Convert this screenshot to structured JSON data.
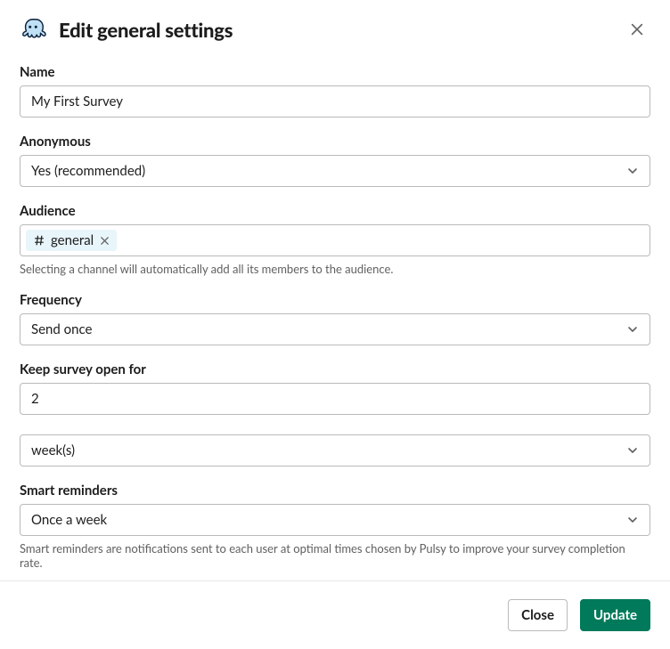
{
  "modal": {
    "title": "Edit general settings"
  },
  "fields": {
    "name": {
      "label": "Name",
      "value": "My First Survey"
    },
    "anonymous": {
      "label": "Anonymous",
      "value": "Yes (recommended)"
    },
    "audience": {
      "label": "Audience",
      "chip_text": "general",
      "helper": "Selecting a channel will automatically add all its members to the audience."
    },
    "frequency": {
      "label": "Frequency",
      "value": "Send once"
    },
    "keep_open": {
      "label": "Keep survey open for",
      "value": "2"
    },
    "keep_open_unit": {
      "value": "week(s)"
    },
    "smart_reminders": {
      "label": "Smart reminders",
      "value": "Once a week",
      "helper": "Smart reminders are notifications sent to each user at optimal times chosen by Pulsy to improve your survey completion rate."
    }
  },
  "footer": {
    "close": "Close",
    "update": "Update"
  }
}
